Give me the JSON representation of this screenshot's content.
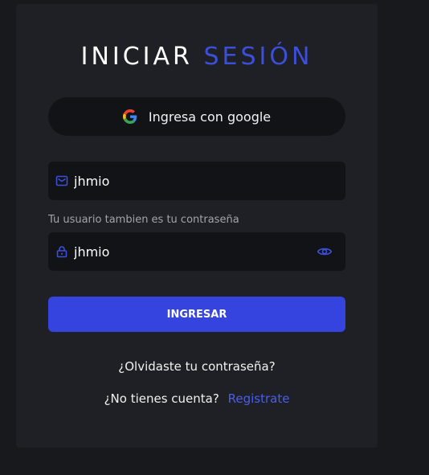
{
  "title": {
    "main": "INICIAR",
    "accent": "SESIÓN"
  },
  "google_button": {
    "label": "Ingresa con google",
    "icon": "google-icon"
  },
  "username": {
    "value": "jhmio",
    "icon": "mail-icon"
  },
  "hint": "Tu usuario tambien es tu contraseña",
  "password": {
    "value": "jhmio",
    "icon": "lock-icon",
    "toggle_icon": "eye-icon"
  },
  "submit_label": "INGRESAR",
  "forgot_link": "¿Olvidaste tu contraseña?",
  "signup": {
    "prompt": "¿No tienes cuenta?",
    "link": "Registrate"
  },
  "colors": {
    "page_bg": "#18191c",
    "card_bg": "#1f2025",
    "field_bg": "#121316",
    "accent": "#3543df",
    "link": "#4a5ee8"
  }
}
